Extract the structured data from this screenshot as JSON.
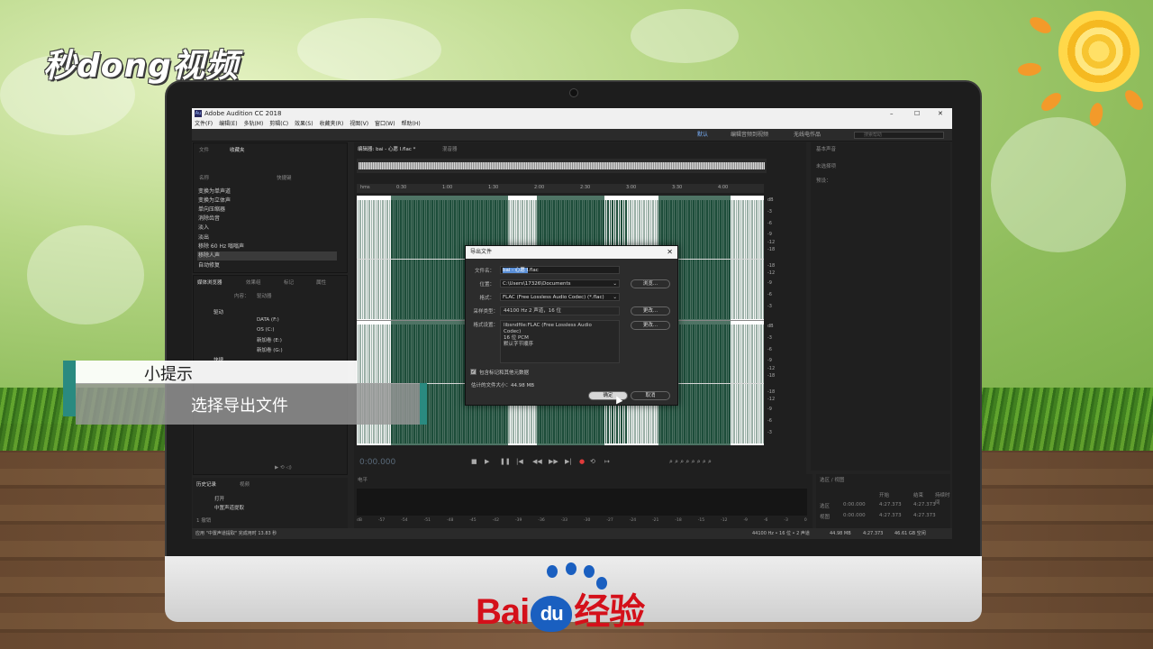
{
  "site_logo": "秒dong视频",
  "baidu": {
    "prefix": "Bai",
    "du": "du",
    "suffix": "经验"
  },
  "tip": {
    "title": "小提示",
    "text": "选择导出文件"
  },
  "window": {
    "title": "Adobe Audition CC 2018",
    "controls": [
      "–",
      "☐",
      "✕"
    ]
  },
  "menu": [
    "文件(F)",
    "编辑(E)",
    "多轨(M)",
    "剪辑(C)",
    "效果(S)",
    "收藏夹(R)",
    "视图(V)",
    "窗口(W)",
    "帮助(H)"
  ],
  "workspaces": [
    "默认",
    "编辑音频到视频",
    "无线电作品"
  ],
  "search_placeholder": "搜索帮助",
  "left_panel": {
    "tabs": [
      "文件",
      "收藏夹"
    ],
    "columns": [
      "名称",
      "快捷键"
    ],
    "effects": [
      "变换为单声道",
      "变换为立体声",
      "单向压缩器",
      "消除齿音",
      "淡入",
      "淡出",
      "移除 60 Hz 嗡嗡声",
      "移除人声",
      "自动修复"
    ],
    "selected_effect": "移除人声"
  },
  "media_panel": {
    "tabs": [
      "媒体浏览器",
      "效果组",
      "标记",
      "属性"
    ],
    "content_label": "内容：",
    "content_value": "驱动器",
    "tree": [
      "驱动",
      "DATA (F:)",
      "OS (C:)",
      "新加卷 (E:)",
      "新加卷 (G:)",
      "快捷"
    ]
  },
  "history_panel": {
    "tabs": [
      "历史记录",
      "视频"
    ],
    "items": [
      "打开",
      "中置声道提取"
    ],
    "footer": "1 撤销",
    "status": "应用 \"中置声道提取\" 完成用时 13.83 秒"
  },
  "editor": {
    "tab": "编辑器: bai - 心愿 l.flac *",
    "mixer_tab": "混音器",
    "ruler": [
      "hms",
      "0:30",
      "1:00",
      "1:30",
      "2:00",
      "2:30",
      "3:00",
      "3:30",
      "4:00"
    ],
    "db_top": [
      "dB",
      "-3",
      "-6",
      "-9",
      "-12",
      "-18",
      "-18",
      "-12",
      "-9",
      "-6",
      "-3"
    ],
    "db_bottom": [
      "dB",
      "-3",
      "-6",
      "-9",
      "-12",
      "-18",
      "-18",
      "-12",
      "-9",
      "-6",
      "-3"
    ],
    "timecode": "0:00.000"
  },
  "right_panel": {
    "title": "基本声音",
    "row1": "未选择项",
    "row2": "预设："
  },
  "levels": {
    "title": "电平",
    "scale": [
      "dB",
      "-57",
      "-54",
      "-51",
      "-48",
      "-45",
      "-42",
      "-39",
      "-36",
      "-33",
      "-30",
      "-27",
      "-24",
      "-21",
      "-18",
      "-15",
      "-12",
      "-9",
      "-6",
      "-3",
      "0"
    ]
  },
  "selection_view": {
    "title": "选区 / 视图",
    "headers": [
      "",
      "开始",
      "结束",
      "持续时间"
    ],
    "rows": [
      [
        "选区",
        "0:00.000",
        "4:27.373",
        "4:27.373"
      ],
      [
        "视图",
        "0:00.000",
        "4:27.373",
        "4:27.373"
      ]
    ]
  },
  "statusbar": [
    "44100 Hz • 16 位 • 2 声道",
    "44.98 MB",
    "4:27.373",
    "46.61 GB 空闲"
  ],
  "dialog": {
    "title": "导出文件",
    "filename_label": "文件名：",
    "filename_selected": "bai - 心愿 l",
    "filename_ext": ".flac",
    "location_label": "位置：",
    "location_value": "C:\\Users\\17326\\Documents",
    "browse": "浏览...",
    "format_label": "格式：",
    "format_value": "FLAC (Free Lossless Audio Codec) (*.flac)",
    "sample_label": "采样类型：",
    "sample_value": "44100 Hz 2 声道，16 位",
    "change1": "更改...",
    "format_settings_label": "格式设置：",
    "format_settings_lines": [
      "libsndfile:FLAC (Free Lossless Audio",
      "Codec)",
      "16 位 PCM",
      "默认字节顺序"
    ],
    "change2": "更改...",
    "include_markers": "包含标记和其他元数据",
    "est_size": "估计的文件大小：44.98 MB",
    "ok": "确定",
    "cancel": "取消"
  }
}
